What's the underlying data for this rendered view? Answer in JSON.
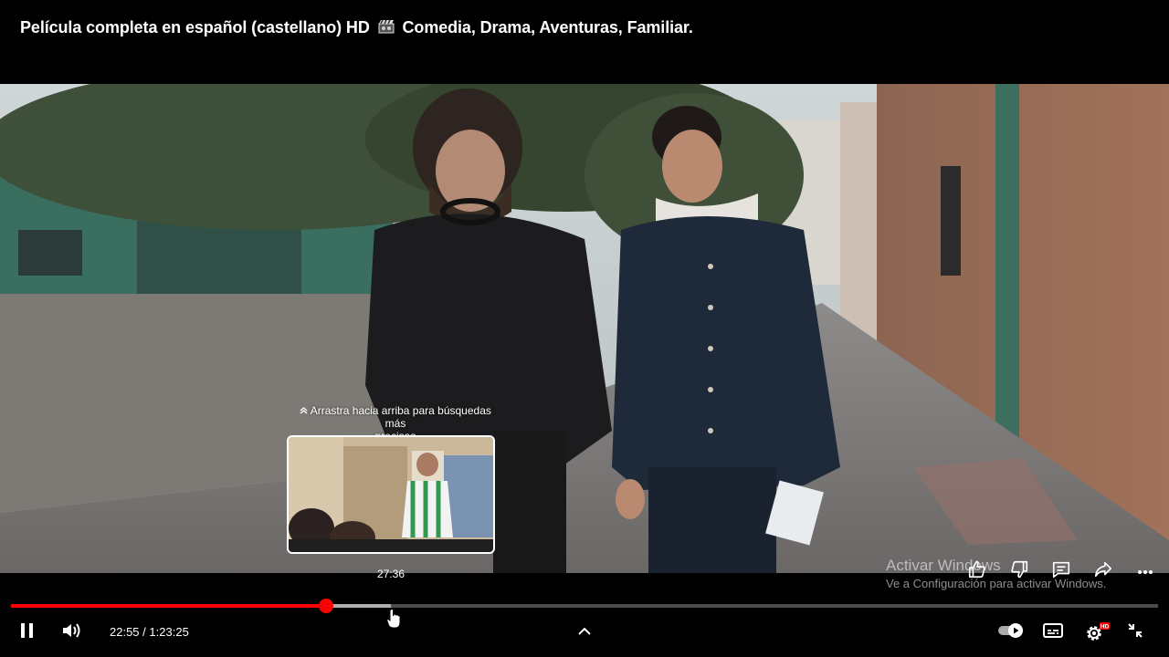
{
  "header": {
    "title_part1": "Película completa en español (castellano) HD",
    "title_part2": "Comedia, Drama, Aventuras, Familiar."
  },
  "scrub_hint": {
    "line1": "Arrastra hacia arriba para búsquedas más",
    "line2": "precisas"
  },
  "preview": {
    "time": "27:36"
  },
  "watermark": {
    "line1": "Activar Windows",
    "line2": "Ve a Configuración para activar Windows."
  },
  "player": {
    "current_time": "22:55",
    "separator": "/",
    "duration": "1:23:25",
    "time_display": "22:55 / 1:23:25",
    "played_fraction": 0.2748,
    "buffered_fraction": 0.331,
    "autoplay": true,
    "quality_badge": "HD"
  },
  "colors": {
    "accent": "#ff0000",
    "background": "#000000",
    "text": "#ffffff"
  },
  "icons": {
    "pause": "pause-icon",
    "volume": "volume-icon",
    "chevron": "chevron-up-icon",
    "autoplay": "autoplay-toggle-icon",
    "subtitles": "subtitles-icon",
    "settings": "gear-icon",
    "exit_fullscreen": "exit-fullscreen-icon",
    "like": "thumbs-up-icon",
    "dislike": "thumbs-down-icon",
    "comments": "comment-icon",
    "share": "share-icon",
    "more": "more-icon"
  }
}
